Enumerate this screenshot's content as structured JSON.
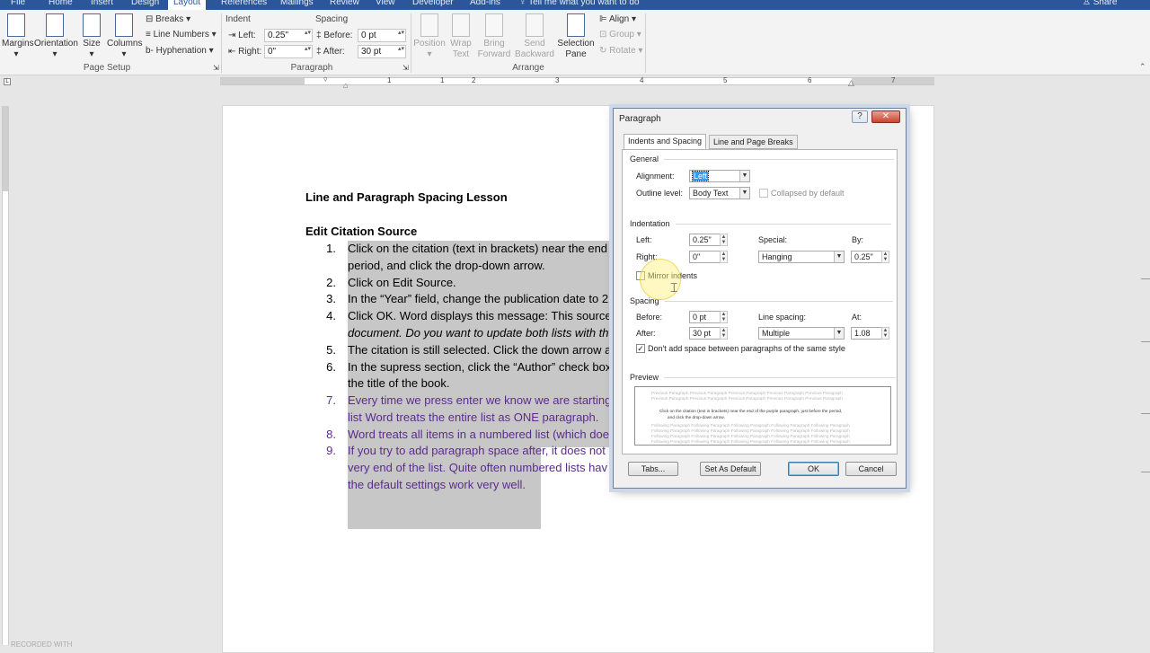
{
  "tabs": [
    "File",
    "Home",
    "Insert",
    "Design",
    "Layout",
    "References",
    "Mailings",
    "Review",
    "View",
    "Developer",
    "Add-ins"
  ],
  "active_tab": "Layout",
  "tell_me": "Tell me what you want to do",
  "share": "Share",
  "ribbon": {
    "margins": "Margins",
    "orientation": "Orientation",
    "size": "Size",
    "columns": "Columns",
    "breaks": "Breaks",
    "line_numbers": "Line Numbers",
    "hyphenation": "Hyphenation",
    "page_setup": "Page Setup",
    "indent": "Indent",
    "spacing": "Spacing",
    "left_label": "Left:",
    "left_value": "0.25\"",
    "right_label": "Right:",
    "right_value": "0\"",
    "before_label": "Before:",
    "before_value": "0 pt",
    "after_label": "After:",
    "after_value": "30 pt",
    "paragraph": "Paragraph",
    "position": "Position",
    "wrap_text": "Wrap Text",
    "bring_forward": "Bring Forward",
    "send_backward": "Send Backward",
    "selection_pane": "Selection Pane",
    "align": "Align",
    "group": "Group",
    "rotate": "Rotate",
    "arrange": "Arrange"
  },
  "ruler_numbers": [
    "1",
    "1",
    "2",
    "3",
    "4",
    "5",
    "6",
    "7"
  ],
  "document": {
    "title": "Line and Paragraph Spacing Lesson",
    "heading": "Edit Citation Source",
    "items": [
      {
        "num": "1.",
        "lines": [
          "Click on the citation (text in brackets) near the end",
          "period, and click the drop-down arrow."
        ]
      },
      {
        "num": "2.",
        "lines": [
          "Click on Edit Source."
        ]
      },
      {
        "num": "3.",
        "lines": [
          "In the “Year” field, change the publication date to 2"
        ]
      },
      {
        "num": "4.",
        "lines": [
          "Click OK. Word displays this message: This source e",
          "document. Do you want to update both lists with th"
        ]
      },
      {
        "num": "5.",
        "lines": [
          "The citation is still selected. Click the down arrow a"
        ]
      },
      {
        "num": "6.",
        "lines": [
          "In the supress section, click the “Author” check box",
          "the title of the book."
        ]
      },
      {
        "num": "7.",
        "lines": [
          "Every time we press enter we know we are starting",
          "list Word treats the entire list as ONE paragraph."
        ]
      },
      {
        "num": "8.",
        "lines": [
          "Word treats all items in a numbered list (which doe"
        ]
      },
      {
        "num": "9.",
        "lines": [
          "If you try to add paragraph space after, it does not",
          "very end of the list. Quite often numbered lists hav",
          "the default settings work very well."
        ]
      }
    ]
  },
  "dialog": {
    "title": "Paragraph",
    "help": "?",
    "close": "✕",
    "tab_indents": "Indents and Spacing",
    "tab_breaks": "Line and Page Breaks",
    "general": "General",
    "alignment_label": "Alignment:",
    "alignment_value": "Left",
    "outline_label": "Outline level:",
    "outline_value": "Body Text",
    "collapsed": "Collapsed by default",
    "indentation": "Indentation",
    "left_label": "Left:",
    "left_value": "0.25\"",
    "right_label": "Right:",
    "right_value": "0\"",
    "special_label": "Special:",
    "special_value": "Hanging",
    "by_label": "By:",
    "by_value": "0.25\"",
    "mirror": "Mirror indents",
    "spacing": "Spacing",
    "before_label": "Before:",
    "before_value": "0 pt",
    "after_label": "After:",
    "after_value": "30 pt",
    "line_spacing_label": "Line spacing:",
    "line_spacing_value": "Multiple",
    "at_label": "At:",
    "at_value": "1.08",
    "dont_add": "Don't add space between paragraphs of the same style",
    "dont_add_checked": "✓",
    "preview": "Preview",
    "preview_prev": "Previous Paragraph Previous Paragraph Previous Paragraph Previous Paragraph Previous Paragraph",
    "preview_text1": "Click on the citation (text in brackets) near the end of the purple paragraph, just before the period,",
    "preview_text2": "and click the drop-down arrow.",
    "preview_follow": "Following Paragraph Following Paragraph Following Paragraph Following Paragraph Following Paragraph",
    "tabs_btn": "Tabs...",
    "set_default_btn": "Set As Default",
    "ok_btn": "OK",
    "cancel_btn": "Cancel"
  },
  "watermark": "RECORDED WITH"
}
